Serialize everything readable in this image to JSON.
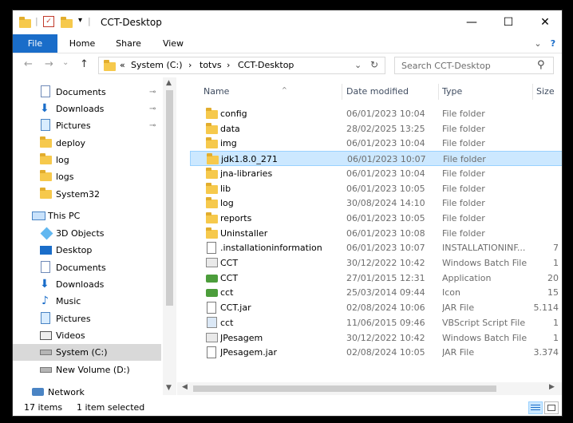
{
  "window": {
    "title": "CCT-Desktop",
    "minimize": "—",
    "maximize": "☐",
    "close": "✕"
  },
  "ribbon": {
    "tabs": [
      "File",
      "Home",
      "Share",
      "View"
    ],
    "expand": "⌄",
    "help": "?"
  },
  "address": {
    "back": "←",
    "forward": "→",
    "recent": "⌄",
    "up": "↑",
    "crumbs": [
      "«",
      "System (C:)",
      "›",
      "totvs",
      "›",
      "CCT-Desktop"
    ],
    "dropdown": "⌄",
    "refresh": "↻"
  },
  "search": {
    "placeholder": "Search CCT-Desktop",
    "icon": "⚲"
  },
  "nav": {
    "items": [
      {
        "label": "Documents",
        "pinned": true,
        "icon": "doc"
      },
      {
        "label": "Downloads",
        "pinned": true,
        "icon": "download"
      },
      {
        "label": "Pictures",
        "pinned": true,
        "icon": "pic"
      },
      {
        "label": "deploy",
        "pinned": false,
        "icon": "folder"
      },
      {
        "label": "log",
        "pinned": false,
        "icon": "folder"
      },
      {
        "label": "logs",
        "pinned": false,
        "icon": "folder"
      },
      {
        "label": "System32",
        "pinned": false,
        "icon": "folder"
      },
      {
        "label": "This PC",
        "pinned": false,
        "icon": "pc"
      },
      {
        "label": "3D Objects",
        "pinned": false,
        "icon": "cube"
      },
      {
        "label": "Desktop",
        "pinned": false,
        "icon": "desktop"
      },
      {
        "label": "Documents",
        "pinned": false,
        "icon": "doc"
      },
      {
        "label": "Downloads",
        "pinned": false,
        "icon": "download"
      },
      {
        "label": "Music",
        "pinned": false,
        "icon": "music"
      },
      {
        "label": "Pictures",
        "pinned": false,
        "icon": "pic"
      },
      {
        "label": "Videos",
        "pinned": false,
        "icon": "video"
      },
      {
        "label": "System (C:)",
        "pinned": false,
        "icon": "drive",
        "selected": true
      },
      {
        "label": "New Volume (D:)",
        "pinned": false,
        "icon": "drive"
      },
      {
        "label": "Network",
        "pinned": false,
        "icon": "network"
      }
    ],
    "pin_glyph": "📌"
  },
  "columns": {
    "name": "Name",
    "date": "Date modified",
    "type": "Type",
    "size": "Size",
    "sort_glyph": "^"
  },
  "files": [
    {
      "name": "config",
      "date": "06/01/2023 10:04",
      "type": "File folder",
      "size": "",
      "icon": "folder"
    },
    {
      "name": "data",
      "date": "28/02/2025 13:25",
      "type": "File folder",
      "size": "",
      "icon": "folder"
    },
    {
      "name": "img",
      "date": "06/01/2023 10:04",
      "type": "File folder",
      "size": "",
      "icon": "folder"
    },
    {
      "name": "jdk1.8.0_271",
      "date": "06/01/2023 10:07",
      "type": "File folder",
      "size": "",
      "icon": "folder",
      "selected": true
    },
    {
      "name": "jna-libraries",
      "date": "06/01/2023 10:04",
      "type": "File folder",
      "size": "",
      "icon": "folder"
    },
    {
      "name": "lib",
      "date": "06/01/2023 10:05",
      "type": "File folder",
      "size": "",
      "icon": "folder"
    },
    {
      "name": "log",
      "date": "30/08/2024 14:10",
      "type": "File folder",
      "size": "",
      "icon": "folder"
    },
    {
      "name": "reports",
      "date": "06/01/2023 10:05",
      "type": "File folder",
      "size": "",
      "icon": "folder"
    },
    {
      "name": "Uninstaller",
      "date": "06/01/2023 10:08",
      "type": "File folder",
      "size": "",
      "icon": "folder"
    },
    {
      "name": ".installationinformation",
      "date": "06/01/2023 10:07",
      "type": "INSTALLATIONINF...",
      "size": "7",
      "icon": "doc"
    },
    {
      "name": "CCT",
      "date": "30/12/2022 10:42",
      "type": "Windows Batch File",
      "size": "1",
      "icon": "batch"
    },
    {
      "name": "CCT",
      "date": "27/01/2015 12:31",
      "type": "Application",
      "size": "20",
      "icon": "app"
    },
    {
      "name": "cct",
      "date": "25/03/2014 09:44",
      "type": "Icon",
      "size": "15",
      "icon": "app"
    },
    {
      "name": "CCT.jar",
      "date": "02/08/2024 10:06",
      "type": "JAR File",
      "size": "5.114",
      "icon": "doc"
    },
    {
      "name": "cct",
      "date": "11/06/2015 09:46",
      "type": "VBScript Script File",
      "size": "1",
      "icon": "script"
    },
    {
      "name": "JPesagem",
      "date": "30/12/2022 10:42",
      "type": "Windows Batch File",
      "size": "1",
      "icon": "batch"
    },
    {
      "name": "JPesagem.jar",
      "date": "02/08/2024 10:05",
      "type": "JAR File",
      "size": "3.374",
      "icon": "doc"
    }
  ],
  "status": {
    "count": "17 items",
    "selection": "1 item selected"
  },
  "colors": {
    "accent": "#1a6dc9",
    "selection": "#cce8ff",
    "folder": "#f6c94c"
  }
}
